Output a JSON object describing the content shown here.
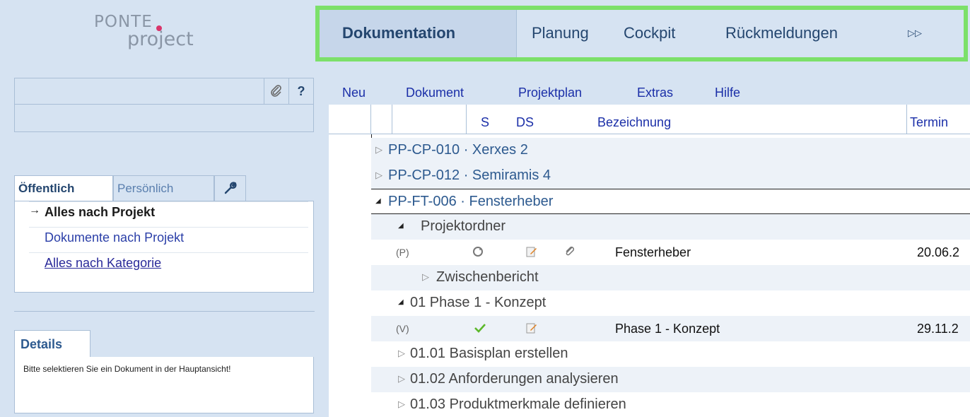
{
  "logo": {
    "line1": "PONTE",
    "line2": "project"
  },
  "search": {
    "attach_symbol": "📎",
    "help_label": "?"
  },
  "sidebar_tabs": [
    {
      "label": "Öffentlich",
      "active": true
    },
    {
      "label": "Persönlich",
      "active": false
    },
    {
      "label": "wrench-icon"
    }
  ],
  "nav": {
    "items": [
      {
        "label": "Alles nach Projekt",
        "arrow": "→"
      },
      {
        "label": "Dokumente nach Projekt"
      },
      {
        "label": "Alles nach Kategorie"
      }
    ]
  },
  "details": {
    "title": "Details",
    "message": "Bitte selektieren Sie ein Dokument in der Hauptansicht!"
  },
  "top_tabs": [
    {
      "label": "Dokumentation",
      "active": true
    },
    {
      "label": "Planung"
    },
    {
      "label": "Cockpit"
    },
    {
      "label": "Rückmeldungen"
    },
    {
      "label": "▷▷"
    }
  ],
  "menu": [
    "Neu",
    "Dokument",
    "Projektplan",
    "Extras",
    "Hilfe"
  ],
  "columns": {
    "s": "S",
    "ds": "DS",
    "name": "Bezeichnung",
    "date": "Termin"
  },
  "rows": [
    {
      "id": "r1",
      "toggle": "▷",
      "label": "PP-CP-010 · Xerxes 2"
    },
    {
      "id": "r2",
      "toggle": "▷",
      "label": "PP-CP-012 · Semiramis 4"
    },
    {
      "id": "r3",
      "toggle": "◢",
      "label": "PP-FT-006 · Fensterheber"
    },
    {
      "id": "r4",
      "toggle": "◢",
      "label": "Projektordner"
    },
    {
      "id": "r5",
      "code": "(P)",
      "name": "Fensterheber",
      "date": "20.06.2"
    },
    {
      "id": "r6",
      "toggle": "▷",
      "label": "Zwischenbericht"
    },
    {
      "id": "r7",
      "toggle": "◢",
      "label": "01 Phase 1 - Konzept"
    },
    {
      "id": "r8",
      "code": "(V)",
      "name": "Phase 1 - Konzept",
      "date": "29.11.2"
    },
    {
      "id": "r9",
      "toggle": "▷",
      "label": "01.01 Basisplan erstellen"
    },
    {
      "id": "r10",
      "toggle": "▷",
      "label": "01.02 Anforderungen analysieren"
    },
    {
      "id": "r11",
      "toggle": "▷",
      "label": "01.03 Produktmerkmale definieren"
    }
  ],
  "colors": {
    "accent": "#24466f",
    "highlight_border": "#7ce06a",
    "sidebar_bg": "#d6e3f2"
  }
}
